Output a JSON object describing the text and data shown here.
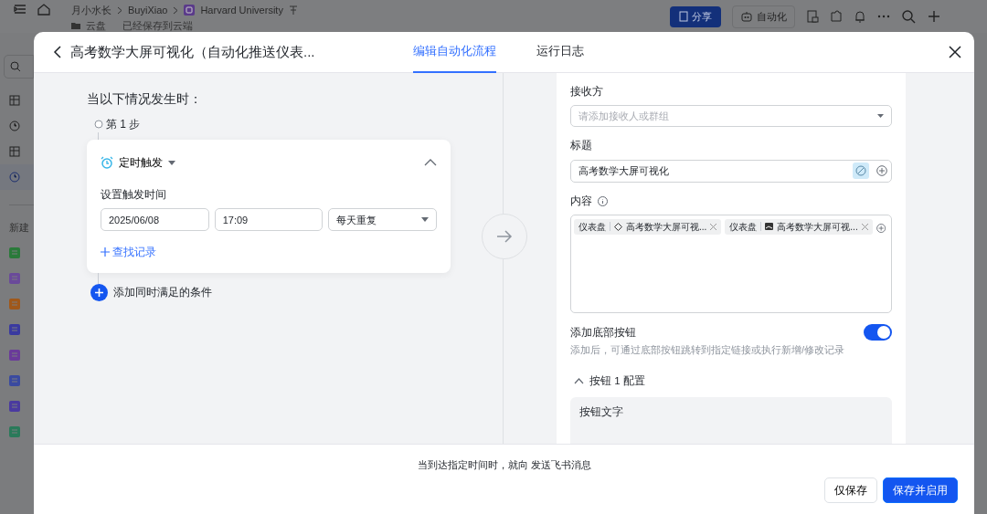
{
  "app": {
    "breadcrumbs": [
      "月小水长",
      "BuyiXiao",
      "Harvard University"
    ],
    "location": "云盘",
    "save_status": "已经保存到云端",
    "share_button": "分享",
    "automation_button": "自动化",
    "sidebar": {
      "items": [
        {
          "selected": false
        },
        {
          "selected": false
        },
        {
          "selected": false
        },
        {
          "selected": true
        }
      ],
      "new_section": {
        "label": "新建",
        "items": [
          {
            "color": "#2a7a3a"
          },
          {
            "color": "#6a4a9a"
          },
          {
            "color": "#a0581a"
          },
          {
            "color": "#3a3aa0"
          },
          {
            "color": "#6a3a9a"
          },
          {
            "color": "#3a4aa0"
          },
          {
            "color": "#4a3aa0"
          },
          {
            "color": "#2a7a5a"
          }
        ]
      }
    }
  },
  "modal": {
    "title": "高考数学大屏可视化（自动化推送仪表...",
    "tabs": [
      {
        "label": "编辑自动化流程",
        "selected": true
      },
      {
        "label": "运行日志",
        "selected": false
      }
    ],
    "trigger": {
      "heading": "当以下情况发生时：",
      "step": "第 1 步",
      "type": "定时触发",
      "expanded": true,
      "field_label": "设置触发时间",
      "date": "2025/06/08",
      "time": "17:09",
      "repeat": "每天重复",
      "find_link": "查找记录",
      "add_condition": "添加同时满足的条件"
    },
    "action": {
      "receiver": {
        "label": "接收方",
        "placeholder": "请添加接收人或群组"
      },
      "title_field": {
        "label": "标题",
        "value": "高考数学大屏可视化"
      },
      "content": {
        "label": "内容",
        "tags": [
          {
            "prefix": "仪表盘",
            "text": "高考数学大屏可视...",
            "kind": "chart"
          },
          {
            "prefix": "仪表盘",
            "text": "高考数学大屏可视...",
            "kind": "image"
          }
        ]
      },
      "bottom_button": {
        "label": "添加底部按钮",
        "on": true,
        "hint": "添加后，可通过底部按钮跳转到指定链接或执行新增/修改记录"
      },
      "button_config": {
        "label": "按钮 1 配置",
        "expanded": true,
        "field_label": "按钮文字"
      }
    },
    "footer": {
      "summary": "当到达指定时间时，就向 发送飞书消息",
      "buttons": [
        {
          "label": "仅保存",
          "kind": "secondary"
        },
        {
          "label": "保存并启用",
          "kind": "primary"
        }
      ]
    }
  }
}
